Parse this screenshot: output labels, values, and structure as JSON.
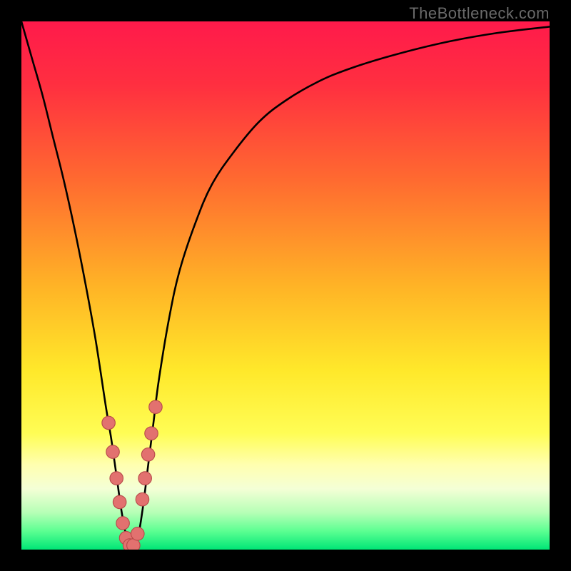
{
  "watermark": "TheBottleneck.com",
  "colors": {
    "frame": "#000000",
    "curve": "#000000",
    "marker_fill": "#e2716f",
    "marker_stroke": "#b74a49",
    "gradient_stops": [
      {
        "offset": 0.0,
        "color": "#ff1a4b"
      },
      {
        "offset": 0.12,
        "color": "#ff2f40"
      },
      {
        "offset": 0.3,
        "color": "#ff6a30"
      },
      {
        "offset": 0.5,
        "color": "#ffb326"
      },
      {
        "offset": 0.66,
        "color": "#ffe82a"
      },
      {
        "offset": 0.78,
        "color": "#fffd55"
      },
      {
        "offset": 0.84,
        "color": "#ffffb0"
      },
      {
        "offset": 0.885,
        "color": "#f4ffd6"
      },
      {
        "offset": 0.93,
        "color": "#b6ffb6"
      },
      {
        "offset": 0.965,
        "color": "#5cff92"
      },
      {
        "offset": 1.0,
        "color": "#00e676"
      }
    ]
  },
  "chart_data": {
    "type": "line",
    "title": "",
    "xlabel": "",
    "ylabel": "",
    "xlim": [
      0,
      100
    ],
    "ylim": [
      0,
      100
    ],
    "series": [
      {
        "name": "bottleneck-curve",
        "x": [
          0,
          2,
          4,
          6,
          8,
          10,
          12,
          14,
          16,
          17,
          18,
          19,
          20,
          21,
          22,
          23,
          24,
          25,
          26,
          28,
          30,
          33,
          36,
          40,
          45,
          50,
          56,
          62,
          70,
          80,
          90,
          100
        ],
        "y": [
          100,
          93,
          86,
          78,
          70,
          61,
          51,
          40,
          27,
          21,
          14,
          7,
          2,
          0,
          2,
          8,
          16,
          24,
          32,
          44,
          53,
          62,
          69,
          75,
          81,
          85,
          88.5,
          91,
          93.5,
          96,
          97.8,
          99
        ]
      }
    ],
    "markers": {
      "name": "highlight-points",
      "x": [
        16.5,
        17.3,
        18.0,
        18.6,
        19.2,
        19.8,
        20.5,
        21.2,
        22.0,
        22.9,
        23.4,
        24.0,
        24.6,
        25.4
      ],
      "y": [
        24.0,
        18.5,
        13.5,
        9.0,
        5.0,
        2.2,
        0.8,
        0.8,
        3.0,
        9.5,
        13.5,
        18.0,
        22.0,
        27.0
      ]
    }
  }
}
